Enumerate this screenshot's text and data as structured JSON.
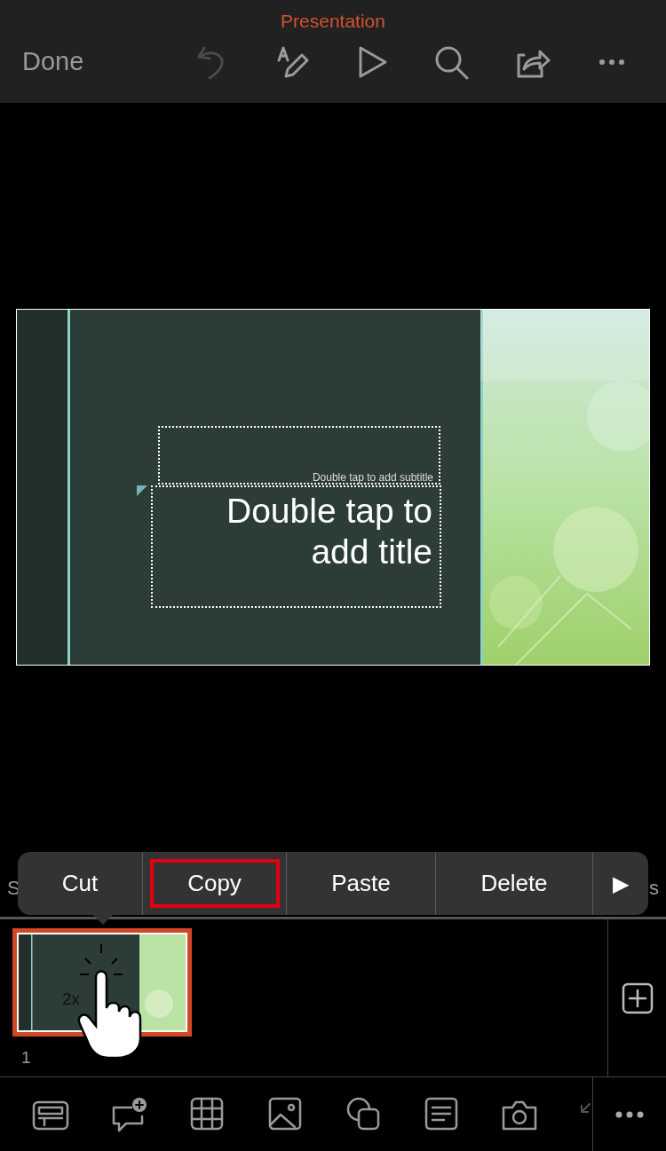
{
  "window": {
    "title": "Presentation"
  },
  "toolbar": {
    "done": "Done",
    "undo": {
      "disabled": true
    }
  },
  "slide": {
    "subtitle_placeholder": "Double tap to add subtitle",
    "title_placeholder": "Double tap to\nadd title"
  },
  "panel_header": {
    "left_fragment": "S",
    "right_fragment": "s"
  },
  "context_menu": {
    "items": [
      {
        "label": "Cut",
        "selected": false
      },
      {
        "label": "Copy",
        "selected": true
      },
      {
        "label": "Paste",
        "selected": false
      },
      {
        "label": "Delete",
        "selected": false
      }
    ],
    "more": "▶"
  },
  "thumbnails": [
    {
      "number": "1",
      "selected": true,
      "tap_hint": "2x"
    }
  ]
}
